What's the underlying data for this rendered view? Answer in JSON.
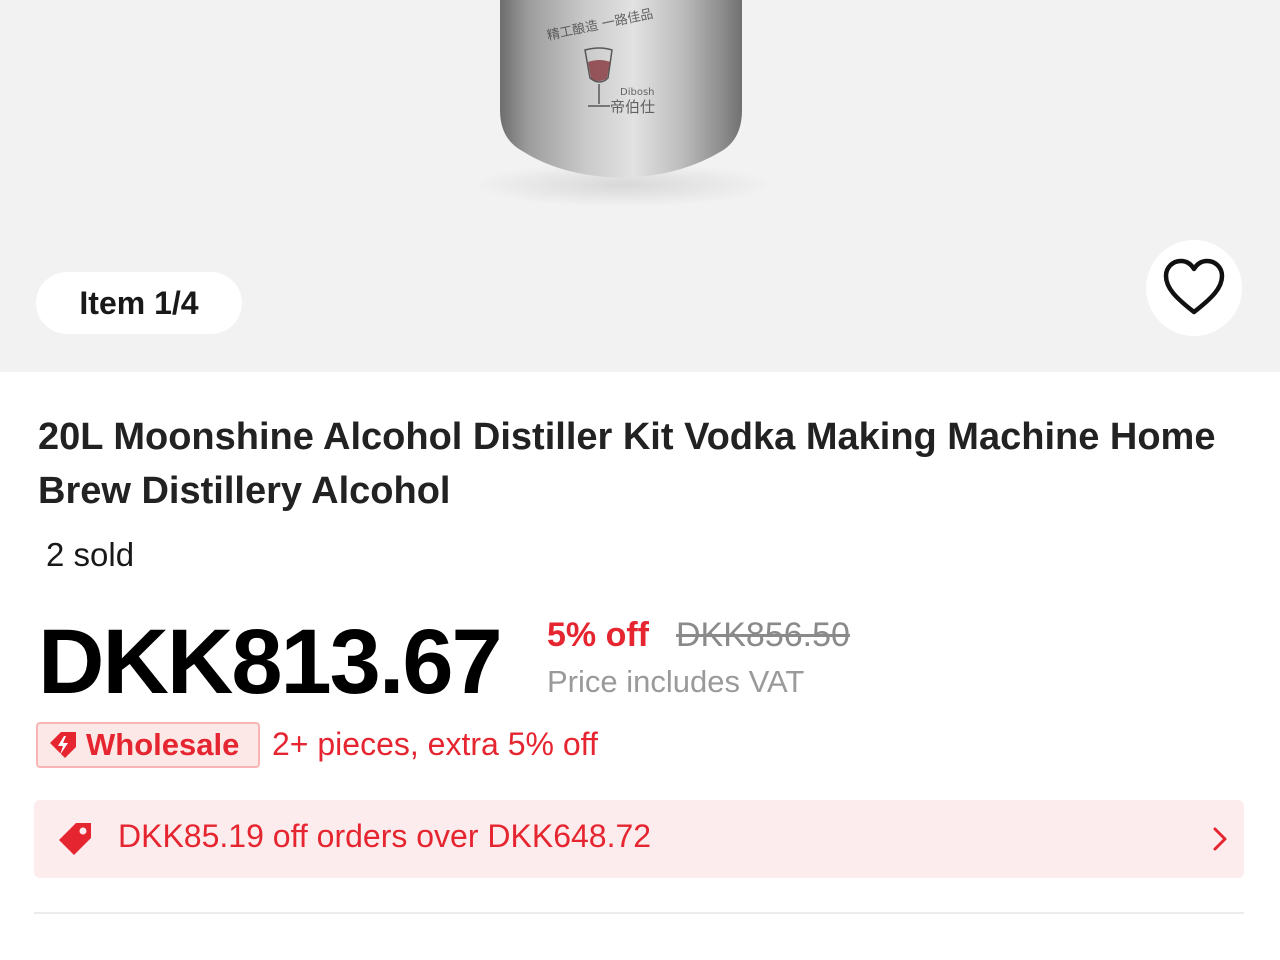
{
  "gallery": {
    "image_counter": "Item 1/4",
    "image_alt": "stainless steel distiller drum",
    "wishlist_icon": "heart-outline-icon"
  },
  "product": {
    "title": "20L Moonshine Alcohol Distiller Kit Vodka Making Machine Home Brew Distillery Alcohol",
    "sold": "2 sold"
  },
  "pricing": {
    "current_price": "DKK813.67",
    "discount": "5% off",
    "original_price": "DKK856.50",
    "vat_note": "Price includes VAT"
  },
  "wholesale": {
    "badge_icon": "lightning-tag-icon",
    "badge_label": "Wholesale",
    "text": "2+ pieces, extra 5% off"
  },
  "coupon": {
    "icon": "tag-icon",
    "text": "DKK85.19 off orders over DKK648.72",
    "chevron": "chevron-right-icon"
  },
  "colors": {
    "accent_red": "#e5252f",
    "badge_bg": "#fde8e8",
    "coupon_bg": "#fdeced",
    "gallery_bg": "#f2f2f2"
  }
}
